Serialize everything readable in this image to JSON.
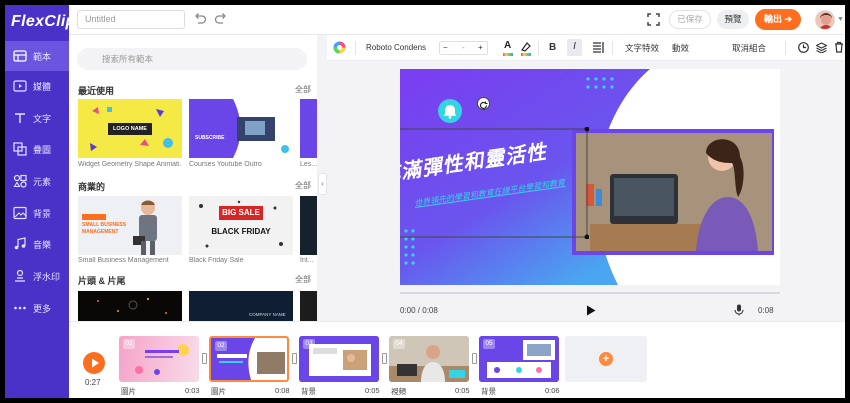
{
  "app": {
    "logo_text": "FlexClip"
  },
  "sidebar": {
    "items": [
      {
        "label": "範本",
        "icon": "template-icon",
        "active": true
      },
      {
        "label": "媒體",
        "icon": "media-icon"
      },
      {
        "label": "文字",
        "icon": "text-icon"
      },
      {
        "label": "疊圖",
        "icon": "overlay-icon"
      },
      {
        "label": "元素",
        "icon": "elements-icon"
      },
      {
        "label": "背景",
        "icon": "background-icon"
      },
      {
        "label": "音樂",
        "icon": "music-icon"
      },
      {
        "label": "浮水印",
        "icon": "watermark-icon"
      },
      {
        "label": "更多",
        "icon": "more-icon"
      }
    ]
  },
  "topbar": {
    "title_placeholder": "Untitled",
    "saved_label": "已保存",
    "preview_label": "預覽",
    "export_label": "輸出",
    "export_icon": "arrow-right-icon"
  },
  "panel": {
    "search_placeholder": "搜索所有範本",
    "sections": [
      {
        "title": "最近使用",
        "all_label": "全部",
        "items": [
          {
            "caption": "Widget Geometry Shape Animati...",
            "text": "LOGO NAME"
          },
          {
            "caption": "Courses Youtube Outro",
            "text": "SUBSCRIBE"
          },
          {
            "caption": "Les..."
          }
        ]
      },
      {
        "title": "商業的",
        "all_label": "全部",
        "items": [
          {
            "caption": "Small Business Management",
            "text": "SMALL BUSINESS MANAGEMENT"
          },
          {
            "caption": "Black Friday Sale",
            "text": "BIG SALE",
            "text2": "BLACK FRIDAY"
          },
          {
            "caption": "Int..."
          }
        ]
      },
      {
        "title": "片頭 & 片尾",
        "all_label": "全部",
        "items": [
          {},
          {
            "text": "COMPANY NAME"
          },
          {}
        ]
      }
    ]
  },
  "toolbar": {
    "font_name": "Roboto Condens",
    "font_size": "-",
    "bold": "B",
    "italic": "I",
    "text_effects": "文字特效",
    "animation": "動效",
    "ungroup": "取消組合"
  },
  "canvas": {
    "headline": "充滿彈性和靈活性",
    "subtext": "世界領先的學習和教育在線平台學習和教育"
  },
  "player": {
    "current_time": "0:00 / 0:08",
    "duration": "0:08"
  },
  "timeline": {
    "total_time": "0:27",
    "clips": [
      {
        "num": "01",
        "type": "圖片",
        "duration": "0:03"
      },
      {
        "num": "02",
        "type": "圖片",
        "duration": "0:08",
        "selected": true
      },
      {
        "num": "03",
        "type": "背景",
        "duration": "0:05"
      },
      {
        "num": "04",
        "type": "視頻",
        "duration": "0:05"
      },
      {
        "num": "05",
        "type": "背景",
        "duration": "0:06"
      }
    ],
    "add_label": "+"
  },
  "colors": {
    "sidebar": "#4a32c8",
    "accent": "#ff6d1f",
    "purple": "#6a46e8",
    "cyan": "#35d3e6"
  }
}
